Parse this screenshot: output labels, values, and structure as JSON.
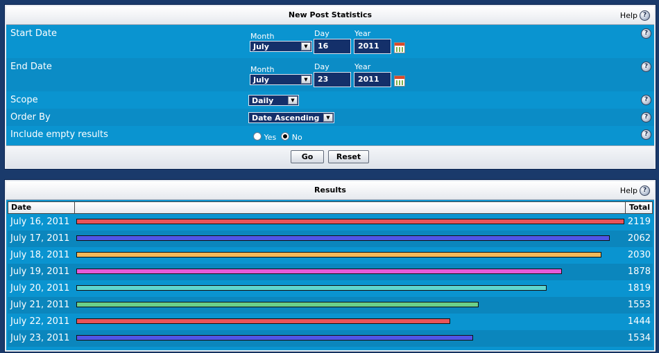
{
  "stats_panel": {
    "title": "New Post Statistics",
    "help_label": "Help",
    "start_date": {
      "label": "Start Date",
      "month_label": "Month",
      "day_label": "Day",
      "year_label": "Year",
      "month": "July",
      "day": "16",
      "year": "2011"
    },
    "end_date": {
      "label": "End Date",
      "month_label": "Month",
      "day_label": "Day",
      "year_label": "Year",
      "month": "July",
      "day": "23",
      "year": "2011"
    },
    "scope": {
      "label": "Scope",
      "value": "Daily"
    },
    "order_by": {
      "label": "Order By",
      "value": "Date Ascending"
    },
    "include_empty": {
      "label": "Include empty results",
      "yes": "Yes",
      "no": "No",
      "selected": "No"
    },
    "go_label": "Go",
    "reset_label": "Reset"
  },
  "results_panel": {
    "title": "Results",
    "help_label": "Help",
    "col_date": "Date",
    "col_total": "Total",
    "rows": [
      {
        "date": "July 16, 2011",
        "total": "2119",
        "value": 2119,
        "color": "#e8545a"
      },
      {
        "date": "July 17, 2011",
        "total": "2062",
        "value": 2062,
        "color": "#5055e6"
      },
      {
        "date": "July 18, 2011",
        "total": "2030",
        "value": 2030,
        "color": "#f2b95a"
      },
      {
        "date": "July 19, 2011",
        "total": "1878",
        "value": 1878,
        "color": "#e85bd8"
      },
      {
        "date": "July 20, 2011",
        "total": "1819",
        "value": 1819,
        "color": "#5fd6cf"
      },
      {
        "date": "July 21, 2011",
        "total": "1553",
        "value": 1553,
        "color": "#6bd08a"
      },
      {
        "date": "July 22, 2011",
        "total": "1444",
        "value": 1444,
        "color": "#e8545a"
      },
      {
        "date": "July 23, 2011",
        "total": "1534",
        "value": 1534,
        "color": "#5055e6"
      }
    ]
  },
  "colors": {
    "panel_bg": "#0a94d0",
    "page_bg": "#1a3a6b"
  },
  "icons": {
    "help": "question-icon",
    "calendar": "calendar-icon"
  }
}
